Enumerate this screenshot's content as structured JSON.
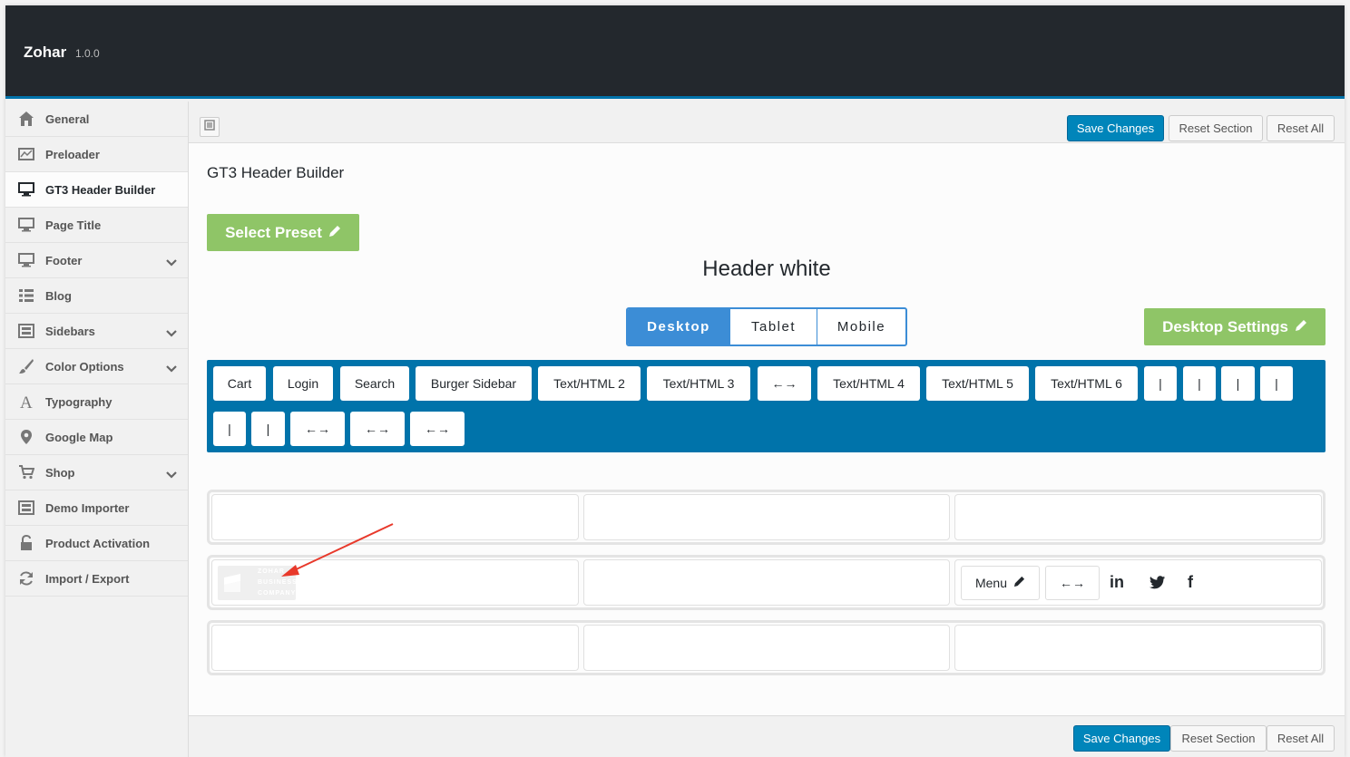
{
  "app": {
    "title": "Zohar",
    "version": "1.0.0"
  },
  "sidebar": {
    "items": [
      {
        "label": "General",
        "icon": "home-icon"
      },
      {
        "label": "Preloader",
        "icon": "chart-icon"
      },
      {
        "label": "GT3 Header Builder",
        "icon": "monitor-icon",
        "active": true
      },
      {
        "label": "Page Title",
        "icon": "monitor-icon"
      },
      {
        "label": "Footer",
        "icon": "monitor-icon",
        "expandable": true
      },
      {
        "label": "Blog",
        "icon": "list-icon"
      },
      {
        "label": "Sidebars",
        "icon": "layout-icon",
        "expandable": true
      },
      {
        "label": "Color Options",
        "icon": "brush-icon",
        "expandable": true
      },
      {
        "label": "Typography",
        "icon": "font-icon"
      },
      {
        "label": "Google Map",
        "icon": "map-pin-icon"
      },
      {
        "label": "Shop",
        "icon": "cart-icon",
        "expandable": true
      },
      {
        "label": "Demo Importer",
        "icon": "layout-icon"
      },
      {
        "label": "Product Activation",
        "icon": "unlock-icon"
      },
      {
        "label": "Import / Export",
        "icon": "refresh-icon"
      }
    ]
  },
  "toolbar": {
    "save": "Save Changes",
    "reset_section": "Reset Section",
    "reset_all": "Reset All"
  },
  "section": {
    "title": "GT3 Header Builder"
  },
  "preset": {
    "button": "Select Preset",
    "name": "Header white"
  },
  "devices": {
    "desktop": "Desktop",
    "tablet": "Tablet",
    "mobile": "Mobile",
    "active": "Desktop"
  },
  "desktop_settings": "Desktop Settings",
  "palette": {
    "items": [
      "Cart",
      "Login",
      "Search",
      "Burger Sidebar",
      "Text/HTML 2",
      "Text/HTML 3",
      "←→",
      "Text/HTML 4",
      "Text/HTML 5",
      "Text/HTML 6",
      "|",
      "|",
      "|",
      "|",
      "|",
      "|",
      "←→",
      "←→",
      "←→"
    ]
  },
  "rows": {
    "middle_right": {
      "menu": "Menu",
      "spacer": "←→",
      "linkedin": "in",
      "twitter": "twitter-icon",
      "facebook": "f"
    },
    "logo_text": [
      "ZOHAR",
      "BUSINESS",
      "COMPANY"
    ]
  },
  "colors": {
    "accent": "#0073aa",
    "primary_button": "#0085ba",
    "green": "#8fc567",
    "device_active": "#3c8dd6",
    "dark": "#23282d",
    "arrow": "#e8392b"
  }
}
